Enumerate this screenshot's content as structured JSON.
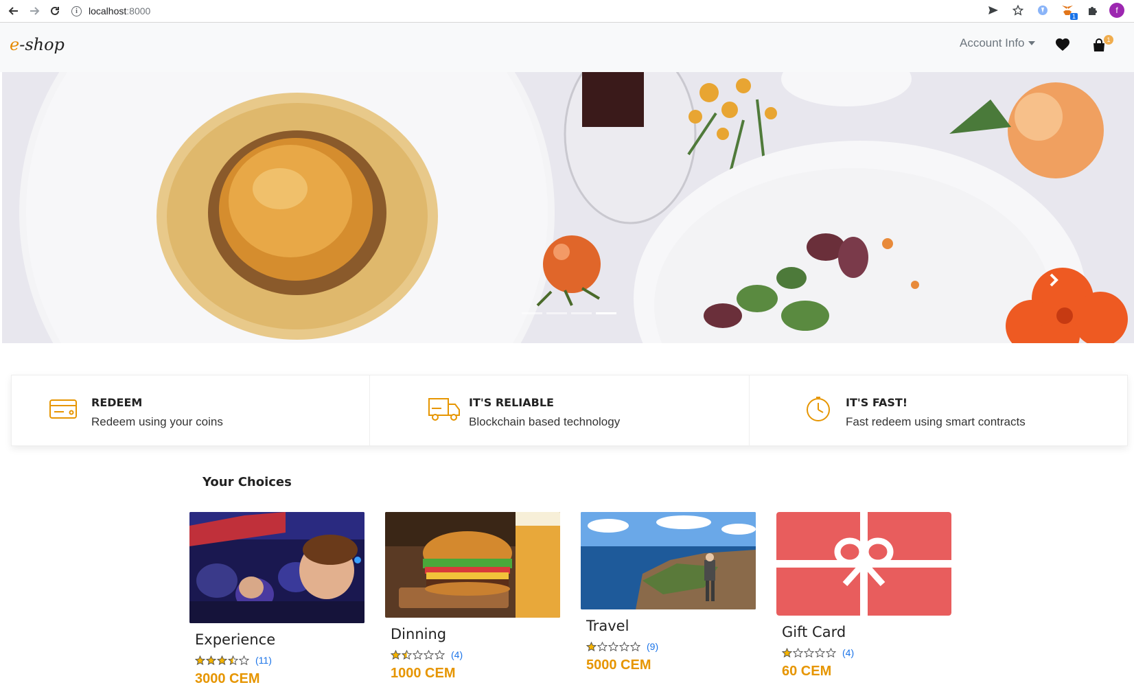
{
  "browser": {
    "url_host": "localhost",
    "url_port": ":8000",
    "profile_initial": "f",
    "extension_badge": "1"
  },
  "navbar": {
    "brand_e": "e",
    "brand_rest": "-shop",
    "account_label": "Account Info",
    "cart_count": "1"
  },
  "hero": {
    "slides": 4,
    "active_slide": 4
  },
  "features": [
    {
      "title": "REDEEM",
      "desc": "Redeem using your coins",
      "icon": "credit-card-icon"
    },
    {
      "title": "IT'S RELIABLE",
      "desc": "Blockchain based technology",
      "icon": "delivery-truck-icon"
    },
    {
      "title": "IT'S FAST!",
      "desc": "Fast redeem using smart contracts",
      "icon": "clock-icon"
    }
  ],
  "choices": {
    "title": "Your Choices",
    "items": [
      {
        "name": "Experience",
        "rating": 3.5,
        "reviews": "(11)",
        "price": "3000 CEM",
        "image": "cinema-audience"
      },
      {
        "name": "Dinning",
        "rating": 1.5,
        "reviews": "(4)",
        "price": "1000 CEM",
        "image": "burger-and-beer"
      },
      {
        "name": "Travel",
        "rating": 1,
        "reviews": "(9)",
        "price": "5000 CEM",
        "image": "coastal-hiker"
      },
      {
        "name": "Gift Card",
        "rating": 1,
        "reviews": "(4)",
        "price": "60 CEM",
        "image": "gift-ribbon"
      }
    ]
  },
  "colors": {
    "accent": "#e69500",
    "link": "#1a73e8",
    "star": "#f5b301",
    "gift_card": "#e85d5d"
  }
}
